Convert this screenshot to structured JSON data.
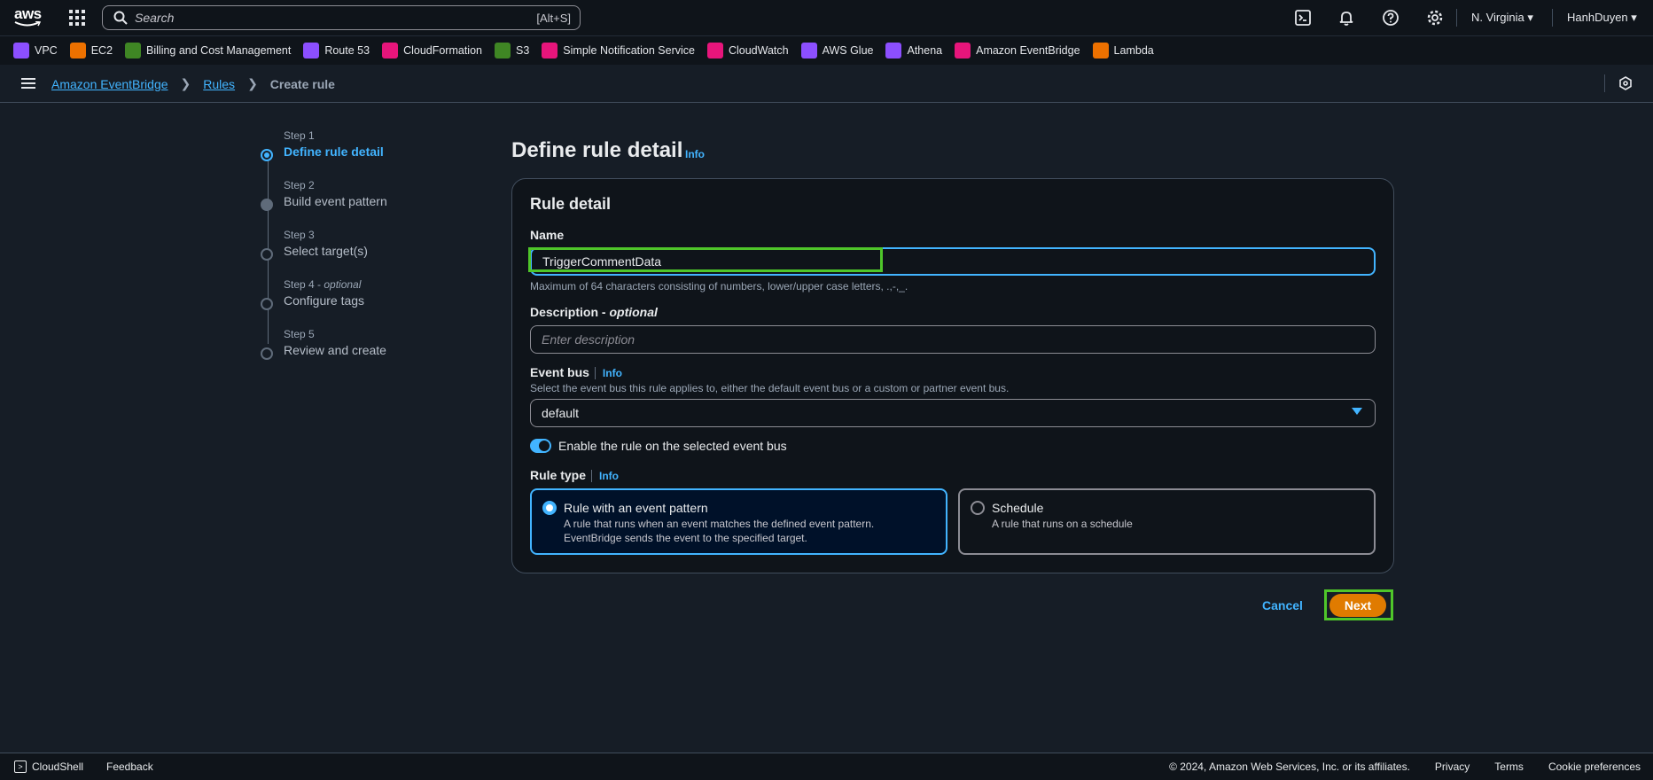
{
  "topbar": {
    "search_placeholder": "Search",
    "search_shortcut": "[Alt+S]",
    "region": "N. Virginia ▾",
    "user": "HanhDuyen ▾"
  },
  "favorites": [
    {
      "label": "VPC",
      "color": "#8c4fff"
    },
    {
      "label": "EC2",
      "color": "#ed7100"
    },
    {
      "label": "Billing and Cost Management",
      "color": "#3f8624"
    },
    {
      "label": "Route 53",
      "color": "#8c4fff"
    },
    {
      "label": "CloudFormation",
      "color": "#e7157b"
    },
    {
      "label": "S3",
      "color": "#3f8624"
    },
    {
      "label": "Simple Notification Service",
      "color": "#e7157b"
    },
    {
      "label": "CloudWatch",
      "color": "#e7157b"
    },
    {
      "label": "AWS Glue",
      "color": "#8c4fff"
    },
    {
      "label": "Athena",
      "color": "#8c4fff"
    },
    {
      "label": "Amazon EventBridge",
      "color": "#e7157b"
    },
    {
      "label": "Lambda",
      "color": "#ed7100"
    }
  ],
  "breadcrumb": {
    "item1": "Amazon EventBridge",
    "item2": "Rules",
    "current": "Create rule"
  },
  "steps": [
    {
      "label": "Step 1",
      "optional": "",
      "name": "Define rule detail"
    },
    {
      "label": "Step 2",
      "optional": "",
      "name": "Build event pattern"
    },
    {
      "label": "Step 3",
      "optional": "",
      "name": "Select target(s)"
    },
    {
      "label": "Step 4 - ",
      "optional": "optional",
      "name": "Configure tags"
    },
    {
      "label": "Step 5",
      "optional": "",
      "name": "Review and create"
    }
  ],
  "page": {
    "title": "Define rule detail",
    "info": "Info"
  },
  "rule_detail": {
    "heading": "Rule detail",
    "name_label": "Name",
    "name_value": "TriggerCommentData",
    "name_help": "Maximum of 64 characters consisting of numbers, lower/upper case letters, .,-,_.",
    "desc_label": "Description - ",
    "desc_optional": "optional",
    "desc_placeholder": "Enter description",
    "bus_label": "Event bus",
    "bus_info": "Info",
    "bus_help": "Select the event bus this rule applies to, either the default event bus or a custom or partner event bus.",
    "bus_value": "default",
    "enable_label": "Enable the rule on the selected event bus",
    "type_label": "Rule type",
    "type_info": "Info",
    "type_pattern_title": "Rule with an event pattern",
    "type_pattern_desc1": "A rule that runs when an event matches the defined event pattern.",
    "type_pattern_desc2": "EventBridge sends the event to the specified target.",
    "type_schedule_title": "Schedule",
    "type_schedule_desc": "A rule that runs on a schedule"
  },
  "actions": {
    "cancel": "Cancel",
    "next": "Next"
  },
  "footer": {
    "cloudshell": "CloudShell",
    "feedback": "Feedback",
    "copyright": "© 2024, Amazon Web Services, Inc. or its affiliates.",
    "privacy": "Privacy",
    "terms": "Terms",
    "cookies": "Cookie preferences"
  }
}
